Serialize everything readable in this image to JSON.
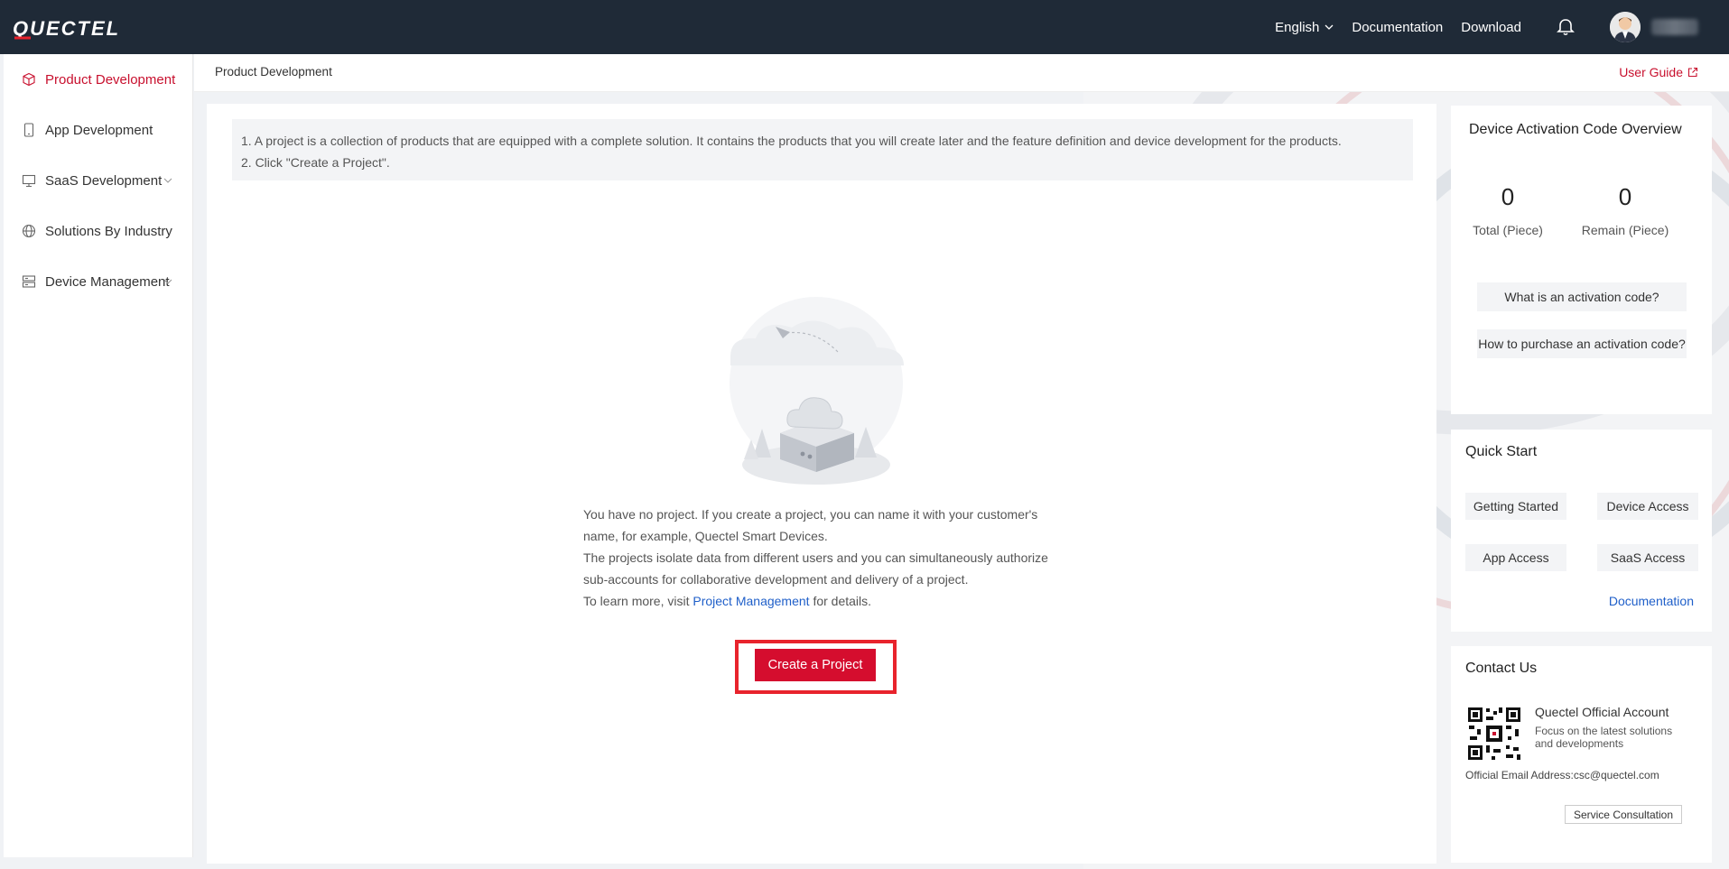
{
  "header": {
    "brand": "QUECTEL",
    "language": "English",
    "documentation": "Documentation",
    "download": "Download"
  },
  "sidebar": {
    "items": [
      {
        "label": "Product Development",
        "icon": "cube-icon",
        "active": true
      },
      {
        "label": "App Development",
        "icon": "phone-icon"
      },
      {
        "label": "SaaS Development",
        "icon": "monitor-icon",
        "expandable": true
      },
      {
        "label": "Solutions By Industry",
        "icon": "globe-icon"
      },
      {
        "label": "Device Management",
        "icon": "server-icon",
        "expandable": true
      }
    ]
  },
  "breadcrumb": "Product Development",
  "user_guide": "User Guide",
  "notice": {
    "line1": "1. A project is a collection of products that are equipped with a complete solution. It contains the products that you will create later and the feature definition and device development for the products.",
    "line2": "2. Click \"Create a Project\"."
  },
  "empty_state": {
    "p1": "You have no project. If you create a project, you can name it with your customer's",
    "p2": "name, for example, Quectel Smart Devices.",
    "p3": "The projects isolate data from different users and you can simultaneously authorize",
    "p4": "sub-accounts for collaborative development and delivery of a project.",
    "p5_before": "To learn more, visit ",
    "p5_link": "Project Management",
    "p5_after": " for details.",
    "button": "Create a Project"
  },
  "activation": {
    "title": "Device Activation Code Overview",
    "total_value": "0",
    "total_label": "Total (Piece)",
    "remain_value": "0",
    "remain_label": "Remain (Piece)",
    "faq1": "What is an activation code?",
    "faq2": "How to purchase an activation code?"
  },
  "quick_start": {
    "title": "Quick Start",
    "items": [
      "Getting Started",
      "Device Access",
      "App Access",
      "SaaS Access"
    ],
    "documentation": "Documentation"
  },
  "contact": {
    "title": "Contact Us",
    "account_name": "Quectel Official Account",
    "account_desc": "Focus on the latest solutions and developments",
    "email": "Official Email Address:csc@quectel.com",
    "service_button": "Service Consultation"
  },
  "colors": {
    "brand_red": "#c8102e",
    "topbar": "#1f2a37",
    "link_blue": "#1f5fc9",
    "highlight_frame": "#e8232c"
  }
}
